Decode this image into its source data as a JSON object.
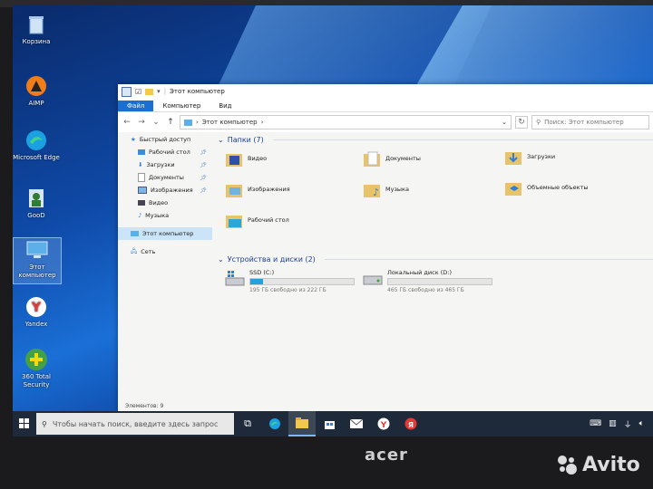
{
  "desktop": {
    "icons": [
      {
        "name": "recycle-bin-icon",
        "label": "Корзина"
      },
      {
        "name": "aimp-icon",
        "label": "AIMP"
      },
      {
        "name": "edge-icon",
        "label": "Microsoft Edge"
      },
      {
        "name": "good-folder-icon",
        "label": "GooD"
      },
      {
        "name": "this-pc-icon",
        "label": "Этот компьютер"
      },
      {
        "name": "yandex-icon",
        "label": "Yandex"
      },
      {
        "name": "360-security-icon",
        "label": "360 Total Security"
      }
    ]
  },
  "explorer": {
    "title": "Этот компьютер",
    "ribbon_tabs": [
      "Файл",
      "Компьютер",
      "Вид"
    ],
    "address": "Этот компьютер",
    "search_placeholder": "Поиск: Этот компьютер",
    "nav": {
      "quick_access": "Быстрый доступ",
      "items": [
        "Рабочий стол",
        "Загрузки",
        "Документы",
        "Изображения",
        "Видео",
        "Музыка"
      ],
      "this_pc": "Этот компьютер",
      "network": "Сеть"
    },
    "folders_header": "Папки (7)",
    "folders": [
      "Видео",
      "Документы",
      "Загрузки",
      "Изображения",
      "Музыка",
      "Объемные объекты",
      "Рабочий стол"
    ],
    "devices_header": "Устройства и диски (2)",
    "drives": [
      {
        "name": "SSD (C:)",
        "free": "195 ГБ свободно из 222 ГБ",
        "used_fraction": 0.12
      },
      {
        "name": "Локальный диск (D:)",
        "free": "465 ГБ свободно из 465 ГБ",
        "used_fraction": 0.0
      }
    ],
    "status": "Элементов: 9"
  },
  "taskbar": {
    "search_placeholder": "Чтобы начать поиск, введите здесь запрос"
  },
  "brand": "acer",
  "watermark": "Avito",
  "colors": {
    "accent": "#1a6fd0",
    "drive_fill": "#26a0da",
    "taskbar": "#1e2a3a"
  }
}
